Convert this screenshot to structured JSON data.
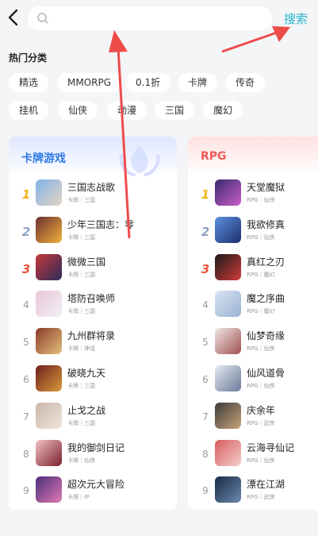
{
  "header": {
    "search_placeholder": "",
    "search_label": "搜索"
  },
  "hot": {
    "title": "热门分类",
    "tags": [
      "精选",
      "MMORPG",
      "0.1折",
      "卡牌",
      "传奇",
      "挂机",
      "仙侠",
      "动漫",
      "三国",
      "魔幻"
    ]
  },
  "cards": [
    {
      "title": "卡牌游戏",
      "games": [
        {
          "rank": "1",
          "name": "三国志战歌",
          "meta": "卡牌｜三国"
        },
        {
          "rank": "2",
          "name": "少年三国志：零",
          "meta": "卡牌｜三国"
        },
        {
          "rank": "3",
          "name": "微微三国",
          "meta": "卡牌｜三国"
        },
        {
          "rank": "4",
          "name": "塔防召唤师",
          "meta": "卡牌｜三国"
        },
        {
          "rank": "5",
          "name": "九州群将录",
          "meta": "卡牌｜神话"
        },
        {
          "rank": "6",
          "name": "破晓九天",
          "meta": "卡牌｜三国"
        },
        {
          "rank": "7",
          "name": "止戈之战",
          "meta": "卡牌｜三国"
        },
        {
          "rank": "8",
          "name": "我的御剑日记",
          "meta": "卡牌｜仙侠"
        },
        {
          "rank": "9",
          "name": "超次元大冒险",
          "meta": "卡牌｜IP"
        }
      ]
    },
    {
      "title": "RPG",
      "games": [
        {
          "rank": "1",
          "name": "天堂魔狱",
          "meta": "RPG｜仙侠"
        },
        {
          "rank": "2",
          "name": "我欲修真",
          "meta": "RPG｜仙侠"
        },
        {
          "rank": "3",
          "name": "真红之刃",
          "meta": "RPG｜魔幻"
        },
        {
          "rank": "4",
          "name": "魔之序曲",
          "meta": "RPG｜魔幻"
        },
        {
          "rank": "5",
          "name": "仙梦奇缘",
          "meta": "RPG｜仙侠"
        },
        {
          "rank": "6",
          "name": "仙风道骨",
          "meta": "RPG｜仙侠"
        },
        {
          "rank": "7",
          "name": "庆余年",
          "meta": "RPG｜武侠"
        },
        {
          "rank": "8",
          "name": "云海寻仙记",
          "meta": "RPG｜仙侠"
        },
        {
          "rank": "9",
          "name": "漂在江湖",
          "meta": "RPG｜武侠"
        }
      ]
    }
  ],
  "colors": {
    "accent": "#25b5c8",
    "card_title_blue": "#2f7be6",
    "card_title_red": "#ee5a55",
    "rank_gold": "#f2b21a",
    "rank_silver": "#8fa3c5",
    "rank_red": "#f0533c",
    "arrow_red": "#ee4b4b"
  }
}
